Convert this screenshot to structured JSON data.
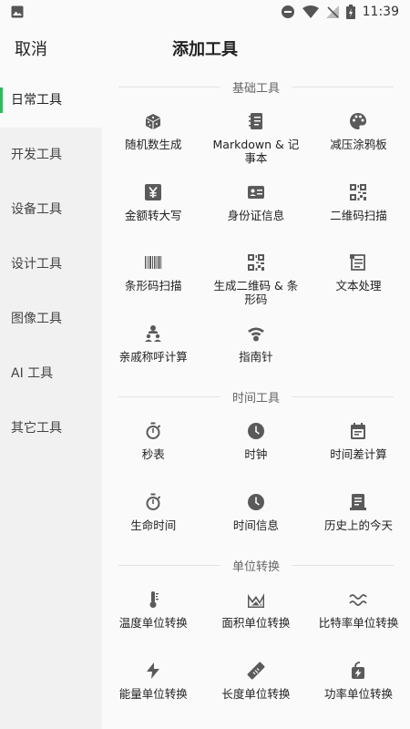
{
  "status": {
    "time": "11:39"
  },
  "header": {
    "cancel_label": "取消",
    "title": "添加工具"
  },
  "sidebar": {
    "items": [
      {
        "label": "日常工具",
        "active": true
      },
      {
        "label": "开发工具"
      },
      {
        "label": "设备工具"
      },
      {
        "label": "设计工具"
      },
      {
        "label": "图像工具"
      },
      {
        "label": "AI 工具"
      },
      {
        "label": "其它工具"
      }
    ]
  },
  "sections": [
    {
      "title": "基础工具",
      "tools": [
        {
          "label": "随机数生成",
          "icon": "dice-icon"
        },
        {
          "label": "Markdown & 记事本",
          "icon": "notebook-icon"
        },
        {
          "label": "减压涂鸦板",
          "icon": "palette-icon"
        },
        {
          "label": "金额转大写",
          "icon": "yen-icon"
        },
        {
          "label": "身份证信息",
          "icon": "id-card-icon"
        },
        {
          "label": "二维码扫描",
          "icon": "qr-code-icon"
        },
        {
          "label": "条形码扫描",
          "icon": "barcode-icon"
        },
        {
          "label": "生成二维码 & 条形码",
          "icon": "qr-code-icon"
        },
        {
          "label": "文本处理",
          "icon": "text-icon"
        },
        {
          "label": "亲戚称呼计算",
          "icon": "family-icon"
        },
        {
          "label": "指南针",
          "icon": "compass-icon"
        }
      ]
    },
    {
      "title": "时间工具",
      "tools": [
        {
          "label": "秒表",
          "icon": "stopwatch-icon"
        },
        {
          "label": "时钟",
          "icon": "clock-icon"
        },
        {
          "label": "时间差计算",
          "icon": "calendar-icon"
        },
        {
          "label": "生命时间",
          "icon": "stopwatch-icon"
        },
        {
          "label": "时间信息",
          "icon": "clock-icon"
        },
        {
          "label": "历史上的今天",
          "icon": "history-icon"
        }
      ]
    },
    {
      "title": "单位转换",
      "tools": [
        {
          "label": "温度单位转换",
          "icon": "thermometer-icon"
        },
        {
          "label": "面积单位转换",
          "icon": "area-chart-icon"
        },
        {
          "label": "比特率单位转换",
          "icon": "wave-icon"
        },
        {
          "label": "能量单位转换",
          "icon": "bolt-icon"
        },
        {
          "label": "长度单位转换",
          "icon": "ruler-icon"
        },
        {
          "label": "功率单位转换",
          "icon": "power-icon"
        }
      ]
    }
  ]
}
